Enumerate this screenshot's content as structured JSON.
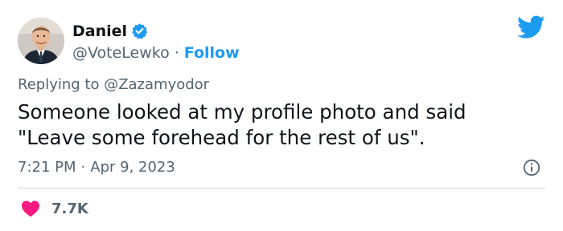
{
  "author": {
    "name": "Daniel",
    "handle": "@VoteLewko",
    "follow_label": "Follow",
    "separator": "·"
  },
  "reply": {
    "text": "Replying to @Zazamyodor"
  },
  "tweet": {
    "text": "Someone looked at my profile photo and said\n\"Leave some forehead for the rest of us\"."
  },
  "meta": {
    "time": "7:21 PM",
    "separator": "·",
    "date": "Apr 9, 2023"
  },
  "likes": {
    "count": "7.7K"
  },
  "icons": {
    "verified": "verified-badge-icon",
    "brand": "twitter-bird-icon",
    "info": "info-icon",
    "like": "heart-icon"
  },
  "colors": {
    "accent": "#1d9bf0",
    "heart": "#f91880",
    "secondary_text": "#536471",
    "primary_text": "#0f1419",
    "divider": "#cfd9de"
  }
}
